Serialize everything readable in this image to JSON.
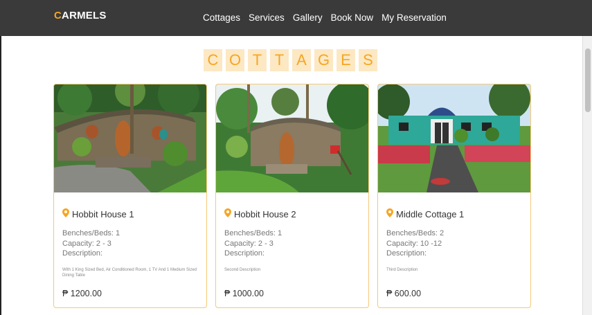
{
  "brand": {
    "first_letter": "C",
    "rest": "ARMELS"
  },
  "nav": [
    "Cottages",
    "Services",
    "Gallery",
    "Book Now",
    "My Reservation"
  ],
  "heading_letters": [
    "C",
    "O",
    "T",
    "T",
    "A",
    "G",
    "E",
    "S"
  ],
  "colors": {
    "accent": "#f5a623",
    "navbar": "#3a3a3a",
    "heading_bg": "#fde8c4",
    "card_border": "#f5c878"
  },
  "cards": [
    {
      "name": "Hobbit House 1",
      "benches": "Benches/Beds: 1",
      "capacity": "Capacity: 2 - 3",
      "description_label": "Description:",
      "description": "With 1 King Sized Bed, Air Conditioned Room, 1 TV And 1 Medium Sized Dining Table",
      "price": "₱ 1200.00",
      "icon": "location-pin-icon"
    },
    {
      "name": "Hobbit House 2",
      "benches": "Benches/Beds: 1",
      "capacity": "Capacity: 2 - 3",
      "description_label": "Description:",
      "description": "Second Description",
      "price": "₱ 1000.00",
      "icon": "location-pin-icon"
    },
    {
      "name": "Middle Cottage 1",
      "benches": "Benches/Beds: 2",
      "capacity": "Capacity: 10 -12",
      "description_label": "Description:",
      "description": "Third Description",
      "price": "₱ 600.00",
      "icon": "location-pin-icon"
    }
  ]
}
